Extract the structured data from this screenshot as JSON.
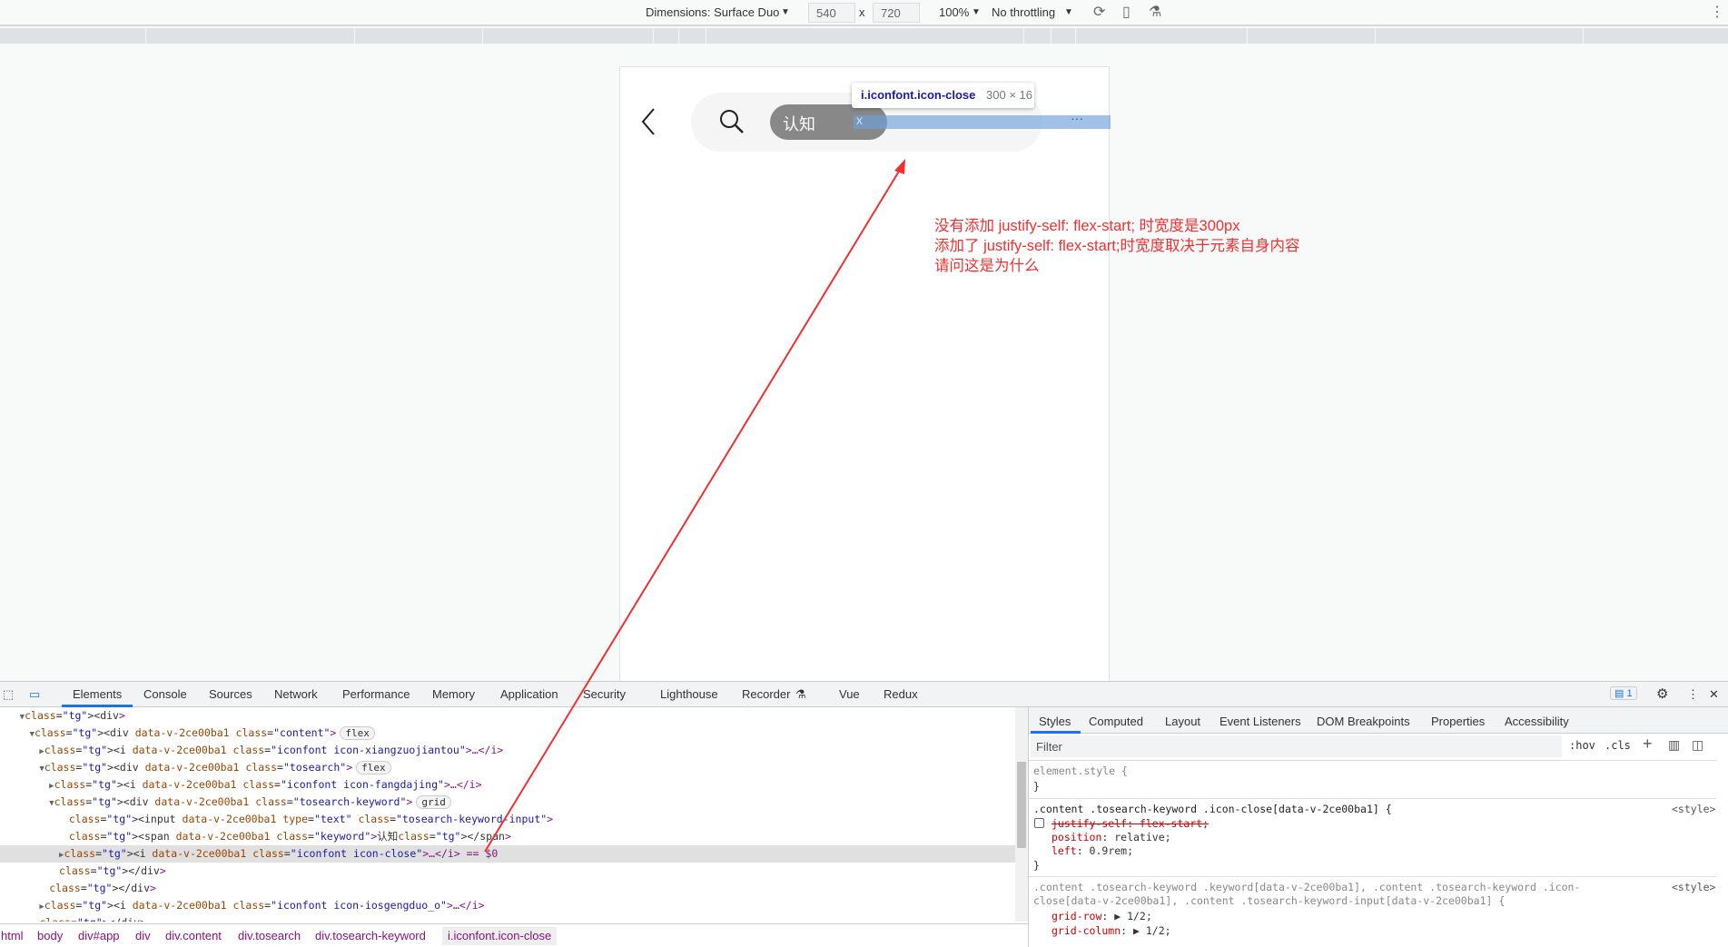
{
  "toolbar": {
    "dimensions": "Dimensions: Surface Duo",
    "width": "540",
    "x": "x",
    "height": "720",
    "zoom": "100%",
    "throttle": "No throttling"
  },
  "page": {
    "keyword": "认知",
    "close_glyph": "x",
    "more_glyph": "···",
    "tooltip_name": "i.iconfont.icon-close",
    "tooltip_size": "300 × 16"
  },
  "annotation": {
    "lines": [
      "没有添加 justify-self: flex-start; 时宽度是300px",
      "添加了 justify-self: flex-start;时宽度取决于元素自身内容",
      "请问这是为什么"
    ],
    "color": "#f03030"
  },
  "devtools": {
    "tabs": [
      "Elements",
      "Console",
      "Sources",
      "Network",
      "Performance",
      "Memory",
      "Application",
      "Security",
      "Lighthouse",
      "Recorder",
      "Vue",
      "Redux"
    ],
    "active_tab": "Elements",
    "issues_count": "1",
    "dom": [
      {
        "d": 3,
        "a": "▼",
        "html": "<div>"
      },
      {
        "d": 4,
        "a": "▼",
        "html": "<div data-v-2ce00ba1 class=\"content\">",
        "badge": "flex"
      },
      {
        "d": 5,
        "a": "▶",
        "html": "<i data-v-2ce00ba1 class=\"iconfont icon-xiangzuojiantou\">",
        "tail": "…</i>"
      },
      {
        "d": 5,
        "a": "▼",
        "html": "<div data-v-2ce00ba1 class=\"tosearch\">",
        "badge": "flex"
      },
      {
        "d": 6,
        "a": "▶",
        "html": "<i data-v-2ce00ba1 class=\"iconfont icon-fangdajing\">",
        "tail": "…</i>"
      },
      {
        "d": 6,
        "a": "▼",
        "html": "<div data-v-2ce00ba1 class=\"tosearch-keyword\">",
        "badge": "grid"
      },
      {
        "d": 7,
        "a": "",
        "html": "<input data-v-2ce00ba1 type=\"text\" class=\"tosearch-keyword-input\">"
      },
      {
        "d": 7,
        "a": "",
        "html": "<span data-v-2ce00ba1 class=\"keyword\">认知</span>"
      },
      {
        "d": 7,
        "a": "▶",
        "html": "<i data-v-2ce00ba1 class=\"iconfont icon-close\">",
        "tail": "…</i> == $0",
        "selected": true
      },
      {
        "d": 6,
        "a": "",
        "html": "</div>"
      },
      {
        "d": 5,
        "a": "",
        "html": "</div>"
      },
      {
        "d": 5,
        "a": "▶",
        "html": "<i data-v-2ce00ba1 class=\"iconfont icon-iosgengduo_o\">",
        "tail": "…</i>"
      },
      {
        "d": 4,
        "a": "",
        "html": "</div>"
      }
    ],
    "breadcrumbs": [
      "html",
      "body",
      "div#app",
      "div",
      "div.content",
      "div.tosearch",
      "div.tosearch-keyword",
      "i.iconfont.icon-close"
    ],
    "styles_tabs": [
      "Styles",
      "Computed",
      "Layout",
      "Event Listeners",
      "DOM Breakpoints",
      "Properties",
      "Accessibility"
    ],
    "filter_placeholder": "Filter",
    "hov": ":hov",
    "cls": ".cls",
    "rules": {
      "element_style": "element.style {",
      "close": "}",
      "r1_selector": ".content .tosearch-keyword .icon-close[data-v-2ce00ba1] {",
      "r1_source": "<style>",
      "r1_p1": "justify-self: flex-start;",
      "r1_p2n": "position",
      "r1_p2v": ": relative;",
      "r1_p3n": "left",
      "r1_p3v": ": 0.9rem;",
      "r2_selector_1": ".content .tosearch-keyword .keyword[data-v-2ce00ba1], .content .tosearch-keyword .icon-",
      "r2_selector_2": "close[data-v-2ce00ba1], .content .tosearch-keyword-input[data-v-2ce00ba1] {",
      "r2_source": "<style>",
      "r2_p1n": "grid-row",
      "r2_p1v": ": ▶ 1/2;",
      "r2_p2n": "grid-column",
      "r2_p2v": ": ▶ 1/2;"
    }
  }
}
